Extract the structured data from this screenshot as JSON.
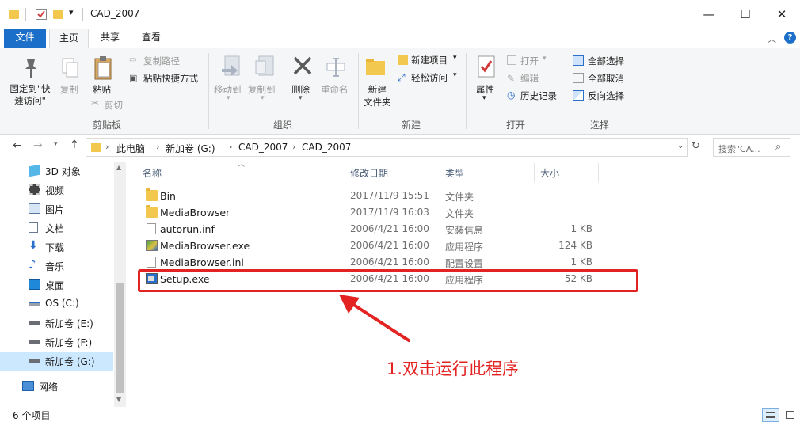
{
  "window": {
    "title": "CAD_2007",
    "controls": {
      "minimize": "—",
      "maximize": "☐",
      "close": "✕"
    }
  },
  "tabs": [
    "文件",
    "主页",
    "共享",
    "查看"
  ],
  "ribbon": {
    "clipboard": {
      "pin_label": "固定到\"快速访问\"",
      "copy_label": "复制",
      "paste_label": "粘贴",
      "copy_path": "复制路径",
      "paste_shortcut": "粘贴快捷方式",
      "cut": "剪切",
      "group": "剪贴板"
    },
    "organize": {
      "move_to": "移动到",
      "copy_to": "复制到",
      "delete": "删除",
      "rename": "重命名",
      "group": "组织"
    },
    "new": {
      "new_folder": "新建\n文件夹",
      "new_item": "新建项目",
      "easy_access": "轻松访问",
      "group": "新建"
    },
    "open": {
      "properties": "属性",
      "open": "打开",
      "edit": "编辑",
      "history": "历史记录",
      "group": "打开"
    },
    "select": {
      "select_all": "全部选择",
      "select_none": "全部取消",
      "invert": "反向选择",
      "group": "选择"
    }
  },
  "address": {
    "crumbs": [
      "此电脑",
      "新加卷 (G:)",
      "CAD_2007",
      "CAD_2007"
    ],
    "search_placeholder": "搜索\"CA..."
  },
  "nav": {
    "items": [
      {
        "label": "3D 对象",
        "icon": "cube-icon"
      },
      {
        "label": "视频",
        "icon": "video-icon"
      },
      {
        "label": "图片",
        "icon": "picture-icon"
      },
      {
        "label": "文档",
        "icon": "document-icon"
      },
      {
        "label": "下载",
        "icon": "download-icon"
      },
      {
        "label": "音乐",
        "icon": "music-icon"
      },
      {
        "label": "桌面",
        "icon": "desktop-icon"
      },
      {
        "label": "OS (C:)",
        "icon": "drive-icon"
      },
      {
        "label": "新加卷 (E:)",
        "icon": "drive-icon"
      },
      {
        "label": "新加卷 (F:)",
        "icon": "drive-icon"
      },
      {
        "label": "新加卷 (G:)",
        "icon": "drive-icon"
      },
      {
        "label": "网络",
        "icon": "network-icon"
      }
    ]
  },
  "list": {
    "columns": [
      "名称",
      "修改日期",
      "类型",
      "大小"
    ],
    "rows": [
      {
        "name": "Bin",
        "date": "2017/11/9 15:51",
        "type": "文件夹",
        "size": "",
        "kind": "folder"
      },
      {
        "name": "MediaBrowser",
        "date": "2017/11/9 16:03",
        "type": "文件夹",
        "size": "",
        "kind": "folder"
      },
      {
        "name": "autorun.inf",
        "date": "2006/4/21 16:00",
        "type": "安装信息",
        "size": "1 KB",
        "kind": "file"
      },
      {
        "name": "MediaBrowser.exe",
        "date": "2006/4/21 16:00",
        "type": "应用程序",
        "size": "124 KB",
        "kind": "exe"
      },
      {
        "name": "MediaBrowser.ini",
        "date": "2006/4/21 16:00",
        "type": "配置设置",
        "size": "1 KB",
        "kind": "file"
      },
      {
        "name": "Setup.exe",
        "date": "2006/4/21 16:00",
        "type": "应用程序",
        "size": "52 KB",
        "kind": "setup"
      }
    ]
  },
  "status": {
    "count": "6 个项目"
  },
  "annotation": {
    "text": "1.双击运行此程序",
    "color": "#e32222"
  },
  "colors": {
    "accent": "#1c6fc9",
    "folder": "#f3c84f",
    "selected": "#cce8ff"
  }
}
